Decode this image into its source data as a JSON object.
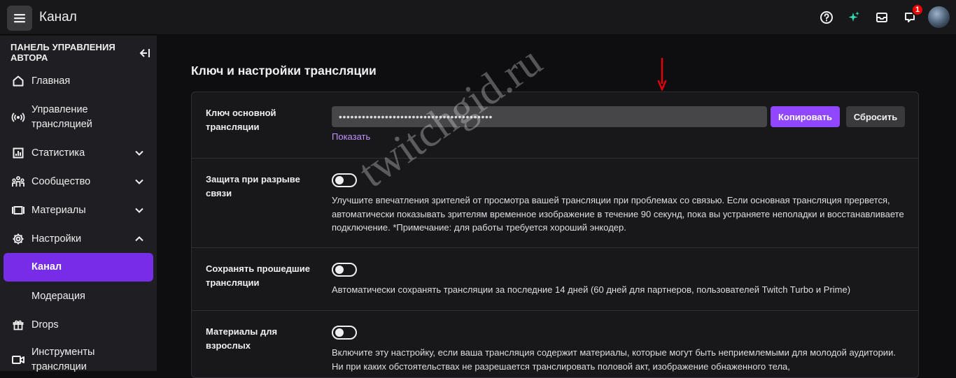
{
  "topbar": {
    "title": "Канал",
    "notification_count": "1",
    "icons": [
      "menu-icon",
      "help-icon",
      "sparkle-icon",
      "inbox-icon",
      "notifications-icon"
    ]
  },
  "sidebar": {
    "heading": "ПАНЕЛЬ УПРАВЛЕНИЯ АВТОРА",
    "items": [
      {
        "label": "Главная",
        "icon": "home-icon"
      },
      {
        "label": "Управление трансляцией",
        "icon": "broadcast-icon"
      },
      {
        "label": "Статистика",
        "icon": "stats-icon",
        "expandable": true
      },
      {
        "label": "Сообщество",
        "icon": "community-icon",
        "expandable": true
      },
      {
        "label": "Материалы",
        "icon": "content-icon",
        "expandable": true
      },
      {
        "label": "Настройки",
        "icon": "settings-icon",
        "expanded": true
      },
      {
        "label": "Канал",
        "active": true
      },
      {
        "label": "Модерация"
      },
      {
        "label": "Drops",
        "icon": "drops-icon"
      },
      {
        "label": "Инструменты трансляции",
        "icon": "tools-icon"
      }
    ]
  },
  "main": {
    "title": "Ключ и настройки трансляции",
    "stream_key": {
      "label": "Ключ основной трансляции",
      "value": "••••••••••••••••••••••••••••••••••••••••",
      "copy_label": "Копировать",
      "reset_label": "Сбросить",
      "show_label": "Показать"
    },
    "disconnect_protection": {
      "label": "Защита при разрыве связи",
      "enabled": false,
      "description": "Улучшите впечатления зрителей от просмотра вашей трансляции при проблемах со связью. Если основная трансляция прервется, автоматически показывать зрителям временное изображение в течение 90 секунд, пока вы устраняете неполадки и восстанавливаете подключение. *Примечание: для работы требуется хороший энкодер."
    },
    "store_past": {
      "label": "Сохранять прошедшие трансляции",
      "enabled": false,
      "description": "Автоматически сохранять трансляции за последние 14 дней (60 дней для партнеров, пользователей Twitch Turbo и Prime)"
    },
    "mature": {
      "label": "Материалы для взрослых",
      "enabled": false,
      "description": "Включите эту настройку, если ваша трансляция содержит материалы, которые могут быть неприемлемыми для молодой аудитории. Ни при каких обстоятельствах не разрешается транслировать половой акт, изображение обнаженного тела,"
    }
  },
  "watermark": "twitchgid.ru",
  "colors": {
    "accent": "#9147ff",
    "active_nav": "#772ce8",
    "link": "#bf94ff",
    "annotation_arrow": "#e3000b"
  }
}
